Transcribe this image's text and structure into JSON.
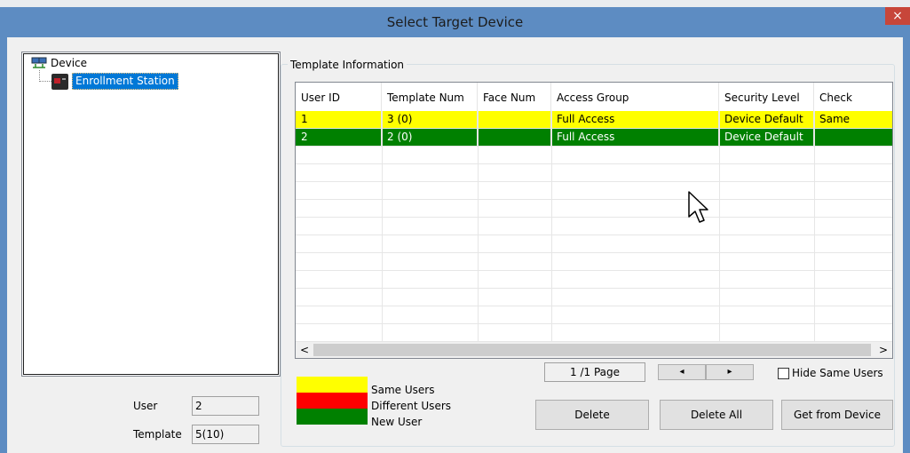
{
  "window": {
    "title": "Select Target Device",
    "close_label": "×"
  },
  "tree": {
    "root": "Device",
    "child": "Enrollment Station"
  },
  "stats": {
    "user_label": "User",
    "user_value": "2",
    "template_label": "Template",
    "template_value": "5(10)"
  },
  "group": {
    "title": "Template Information"
  },
  "table": {
    "columns": [
      "User ID",
      "Template Num",
      "Face Num",
      "Access Group",
      "Security Level",
      "Check"
    ],
    "rows": [
      {
        "cells": [
          "1",
          "3 (0)",
          "",
          "Full Access",
          "Device Default",
          "Same"
        ],
        "color": "#ffff00",
        "text_color": "#000000"
      },
      {
        "cells": [
          "2",
          "2 (0)",
          "",
          "Full Access",
          "Device Default",
          ""
        ],
        "color": "#008000",
        "text_color": "#ffffff"
      }
    ]
  },
  "legend": {
    "items": [
      {
        "label": "Same Users",
        "color": "#ffff00"
      },
      {
        "label": "Different Users",
        "color": "#ff0000"
      },
      {
        "label": "New User",
        "color": "#008000"
      }
    ]
  },
  "pager": {
    "page_text": "1 /1 Page",
    "prev_glyph": "◂",
    "next_glyph": "▸",
    "hide_same_label": "Hide Same Users"
  },
  "buttons": {
    "delete": "Delete",
    "delete_all": "Delete All",
    "get_from_device": "Get from Device"
  },
  "scroll": {
    "left_glyph": "<",
    "right_glyph": ">"
  }
}
